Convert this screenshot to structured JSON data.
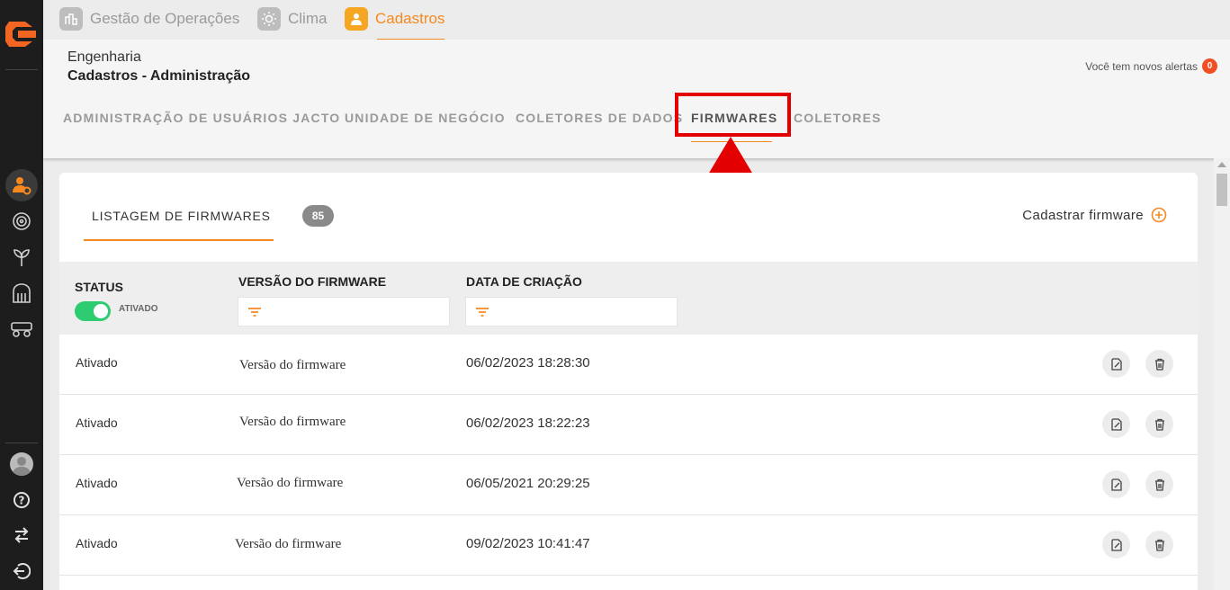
{
  "modules": [
    {
      "label": "Gestão de Operações",
      "icon": "chart-building-icon",
      "active": false
    },
    {
      "label": "Clima",
      "icon": "sun-icon",
      "active": false
    },
    {
      "label": "Cadastros",
      "icon": "user-icon",
      "active": true
    }
  ],
  "breadcrumb": {
    "top": "Engenharia",
    "sub": "Cadastros - Administração"
  },
  "alerts": {
    "text": "Você tem novos alertas",
    "count": "0"
  },
  "tabs": [
    "ADMINISTRAÇÃO DE USUÁRIOS JACTO",
    "UNIDADE DE NEGÓCIO",
    "COLETORES DE DADOS",
    "FIRMWARES",
    "COLETORES"
  ],
  "active_tab": "FIRMWARES",
  "card": {
    "tab_label": "LISTAGEM DE FIRMWARES",
    "count": "85",
    "add_label": "Cadastrar firmware"
  },
  "table": {
    "headers": {
      "status": "STATUS",
      "version": "VERSÃO DO FIRMWARE",
      "date": "DATA DE CRIAÇÃO"
    },
    "status_filter_label": "ATIVADO",
    "rows": [
      {
        "status": "Ativado",
        "version": "Versão do firmware",
        "date": "06/02/2023 18:28:30"
      },
      {
        "status": "Ativado",
        "version": "Versão do firmware",
        "date": "06/02/2023 18:22:23"
      },
      {
        "status": "Ativado",
        "version": "Versão do firmware",
        "date": "06/05/2021 20:29:25"
      },
      {
        "status": "Ativado",
        "version": "Versão do firmware",
        "date": "09/02/2023 10:41:47"
      }
    ]
  },
  "colors": {
    "accent": "#f5891f",
    "sidebar": "#1d1d1d",
    "toggle_on": "#2ecc71",
    "annotation_red": "#e30000",
    "alert_badge": "#f04e23"
  }
}
